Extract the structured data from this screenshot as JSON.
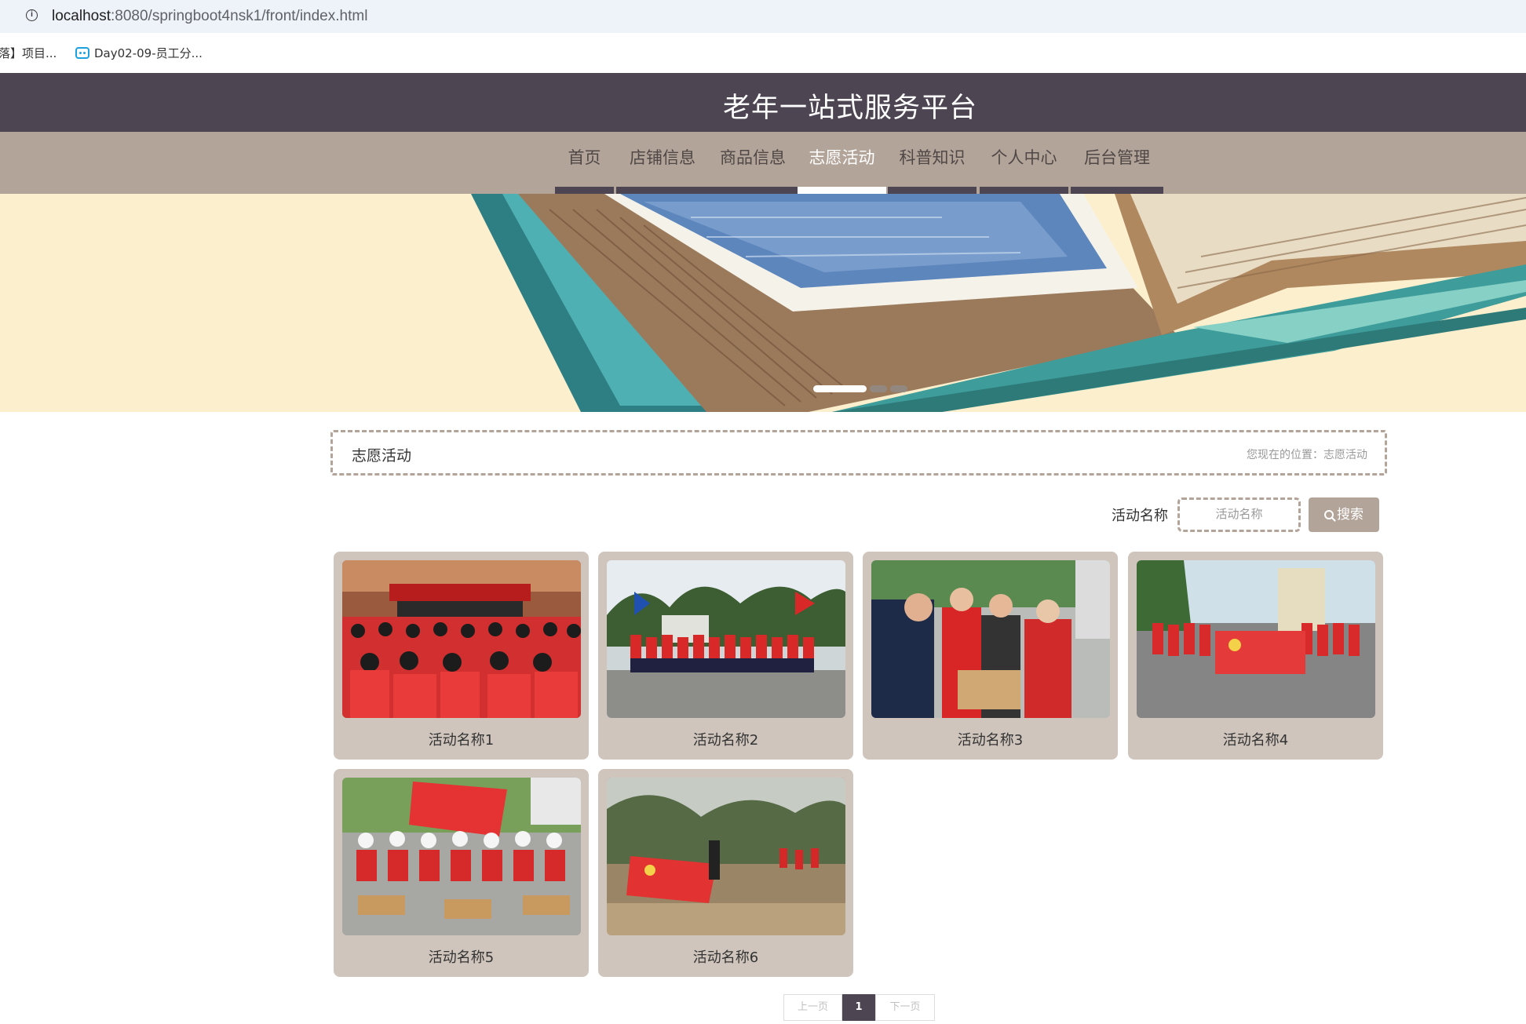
{
  "browser": {
    "url_host": "localhost",
    "url_path": ":8080/springboot4nsk1/front/index.html",
    "bookmarks": [
      {
        "label": "落】项目..."
      },
      {
        "label": "Day02-09-员工分..."
      }
    ]
  },
  "header": {
    "title": "老年一站式服务平台"
  },
  "nav": {
    "items": [
      {
        "label": "首页"
      },
      {
        "label": "店铺信息"
      },
      {
        "label": "商品信息"
      },
      {
        "label": "志愿活动",
        "active": true
      },
      {
        "label": "科普知识"
      },
      {
        "label": "个人中心"
      },
      {
        "label": "后台管理"
      }
    ]
  },
  "banner": {
    "slide_count": 3,
    "active_slide": 1
  },
  "breadcrumb": {
    "title": "志愿活动",
    "position": "您现在的位置：志愿活动"
  },
  "search": {
    "label": "活动名称",
    "placeholder": "活动名称",
    "button_label": "搜索"
  },
  "activities": [
    {
      "name": "活动名称1"
    },
    {
      "name": "活动名称2"
    },
    {
      "name": "活动名称3"
    },
    {
      "name": "活动名称4"
    },
    {
      "name": "活动名称5"
    },
    {
      "name": "活动名称6"
    }
  ],
  "pagination": {
    "prev_label": "上一页",
    "current_page": "1",
    "next_label": "下一页"
  },
  "colors": {
    "header_bg": "#4e4553",
    "nav_bg": "#b3a49a",
    "card_bg": "#cfc5bc",
    "banner_bg": "#fbefcd",
    "volunteer_red": "#e02b2b"
  }
}
